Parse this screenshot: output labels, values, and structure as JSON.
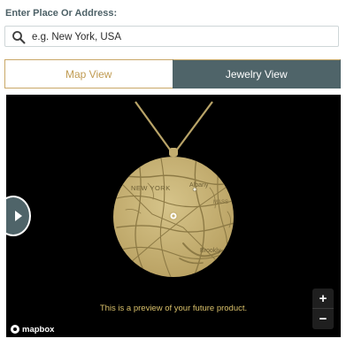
{
  "search": {
    "label": "Enter Place Or Address:",
    "placeholder": "e.g. New York, USA",
    "value": ""
  },
  "tabs": [
    {
      "label": "Map View",
      "active": false
    },
    {
      "label": "Jewelry View",
      "active": true
    }
  ],
  "preview": {
    "map_labels": [
      "NEW YORK",
      "Albany",
      "MASS",
      "Brookly"
    ],
    "caption": "This is a preview of your future product.",
    "attribution": "mapbox",
    "zoom_in": "+",
    "zoom_out": "−"
  },
  "colors": {
    "accent_gold": "#c9a867",
    "tab_active_bg": "#4f6469",
    "pendant_gold": "#c8b375",
    "caption_text": "#d9c06a"
  },
  "icons": {
    "search": "search-icon",
    "toggle": "play-icon",
    "attribution": "mapbox-logo-icon"
  }
}
